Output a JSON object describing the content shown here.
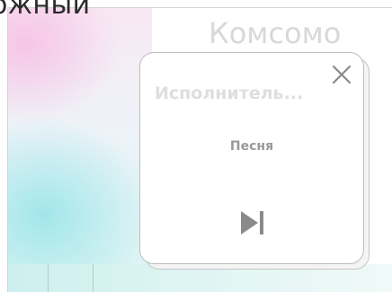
{
  "background": {
    "left_heading": "ожный",
    "right_heading": "Комсомо"
  },
  "popup": {
    "artist": "Исполнитель...",
    "song": "Песня",
    "close_icon": "close-icon",
    "next_icon": "skip-next-icon"
  },
  "colors": {
    "popup_border": "#bdbdbd",
    "artist_text": "#dedede",
    "song_text": "#999999",
    "icon": "#8a8a8a"
  }
}
